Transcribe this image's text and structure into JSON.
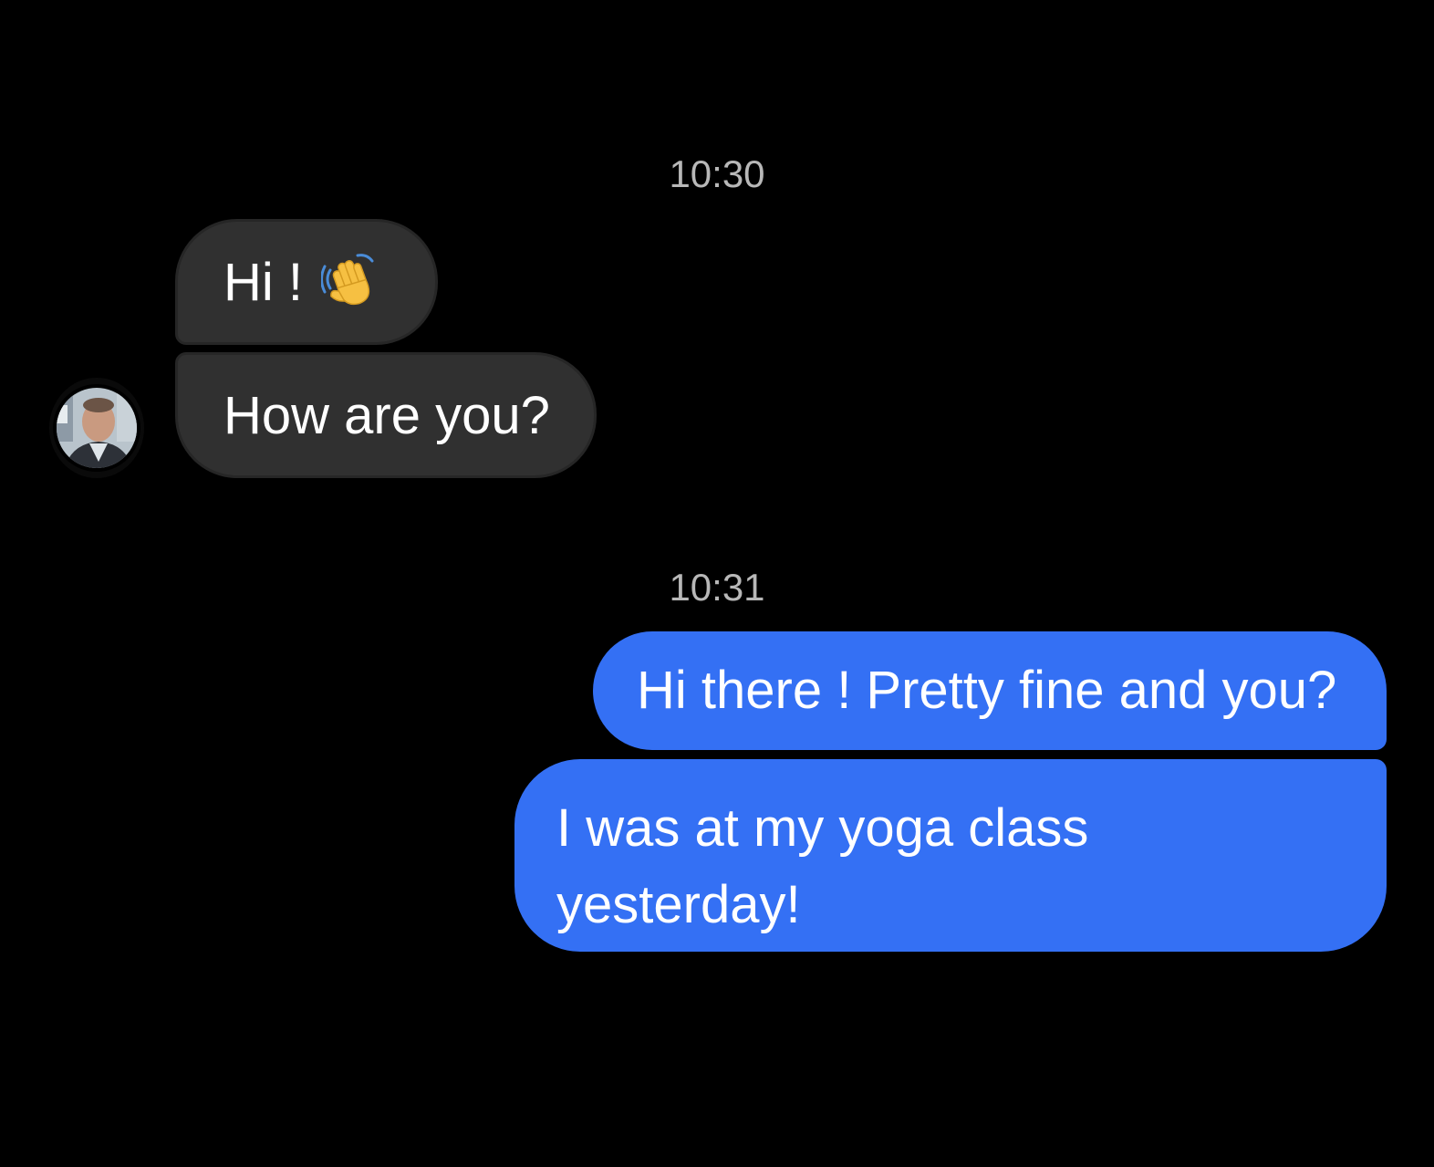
{
  "conversation": {
    "groups": [
      {
        "timestamp": "10:30",
        "messages": [
          {
            "sender": "contact",
            "text": "Hi !",
            "emoji": "waving-hand"
          },
          {
            "sender": "contact",
            "text": "How are you?"
          }
        ]
      },
      {
        "timestamp": "10:31",
        "messages": [
          {
            "sender": "me",
            "text": "Hi there ! Pretty fine and you?"
          },
          {
            "sender": "me",
            "text": "I was at my yoga class yesterday!"
          }
        ]
      }
    ]
  },
  "colors": {
    "background": "#000000",
    "incoming_bubble": "#303030",
    "outgoing_bubble": "#3470f4",
    "timestamp_text": "#b8b8b8"
  }
}
